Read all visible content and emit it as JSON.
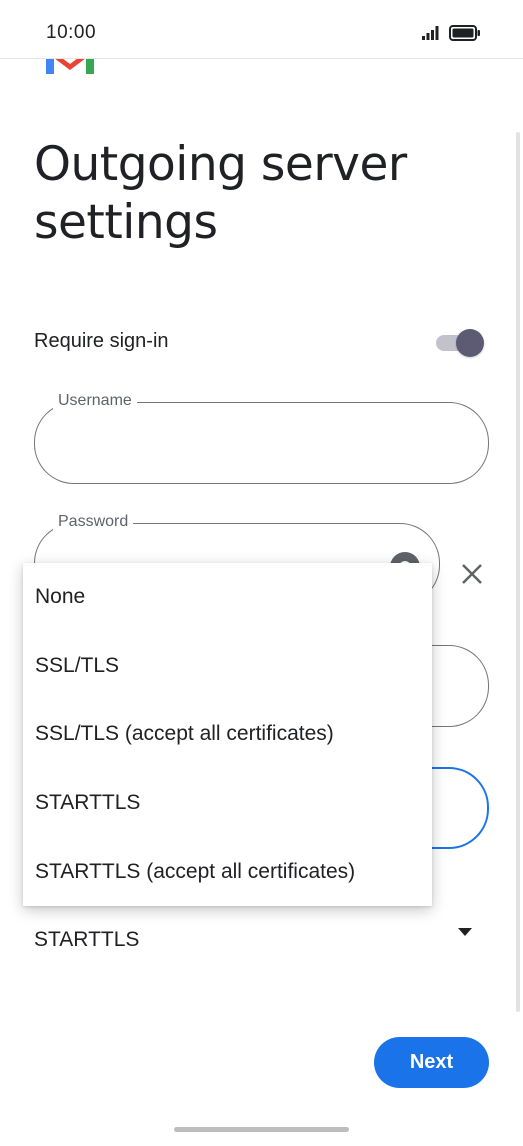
{
  "status_bar": {
    "time": "10:00",
    "icons": [
      "signal-icon",
      "battery-icon"
    ]
  },
  "header": {
    "logo": "gmail-logo",
    "title": "Outgoing server settings"
  },
  "form": {
    "require_signin_label": "Require sign-in",
    "require_signin_enabled": true,
    "username_label": "Username",
    "username_value": "",
    "password_label": "Password",
    "security_type_value": "STARTTLS"
  },
  "security_menu": {
    "options": [
      "None",
      "SSL/TLS",
      "SSL/TLS (accept all certificates)",
      "STARTTLS",
      "STARTTLS (accept all certificates)"
    ]
  },
  "footer": {
    "next_label": "Next"
  },
  "colors": {
    "primary": "#1a73e8",
    "toggle_thumb": "#5c5b73",
    "toggle_track": "#c3c2cc",
    "outline": "#757575"
  }
}
